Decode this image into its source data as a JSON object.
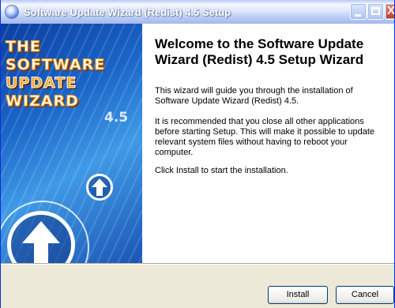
{
  "window": {
    "title": "Software Update Wizard (Redist) 4.5 Setup",
    "close_glyph": "X"
  },
  "sidebar": {
    "logo_lines": [
      "THE",
      "SOFTWARE",
      "UPDATE",
      "WIZARD"
    ],
    "logo_version": "4.5"
  },
  "main": {
    "heading": "Welcome to the Software Update Wizard (Redist) 4.5 Setup Wizard",
    "paragraphs": [
      "This wizard will guide you through the installation of Software Update Wizard (Redist) 4.5.",
      "It is recommended that you close all other applications before starting Setup. This will make it possible to update relevant system files without having to reboot your computer.",
      "Click Install to start the installation."
    ]
  },
  "buttons": {
    "install": "Install",
    "cancel": "Cancel"
  },
  "icons": {
    "app": "setup-globe-icon",
    "minimize": "minimize-icon",
    "maximize": "maximize-icon",
    "close": "close-icon",
    "arrows": "up-arrow-icon"
  }
}
